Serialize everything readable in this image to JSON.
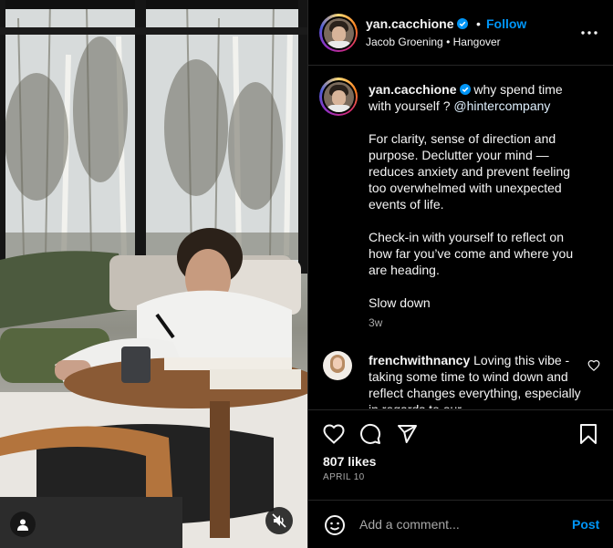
{
  "post": {
    "author": {
      "username": "yan.cacchione",
      "verified": true,
      "follow_label": "Follow",
      "separator": "•"
    },
    "header_sub": {
      "audio": "Jacob Groening",
      "dot": "•",
      "track": "Hangover"
    },
    "caption": {
      "username": "yan.cacchione",
      "line1": "why spend time with yourself ?",
      "mention": "@hintercompany",
      "para2": "For clarity, sense of direction and purpose. Declutter your mind — reduces anxiety and prevent feeling too overwhelmed with unexpected events of life.",
      "para3": "Check-in with yourself to reflect on how far you’ve come and where you are heading.",
      "para4": "Slow down",
      "time": "3w"
    },
    "comments": [
      {
        "username": "frenchwithnancy",
        "text": "Loving this vibe - taking some time to wind down and reflect changes everything, especially in regards to our"
      }
    ],
    "likes": "807 likes",
    "date": "APRIL 10"
  },
  "add_comment": {
    "placeholder": "Add a comment...",
    "post_label": "Post"
  },
  "icons": {
    "more": "more-options-icon",
    "like": "heart-icon",
    "comment": "comment-icon",
    "share": "share-icon",
    "save": "bookmark-icon",
    "emoji": "emoji-icon",
    "tags": "user-tag-icon",
    "mute": "audio-muted-icon"
  },
  "colors": {
    "accent": "#0095f6",
    "background": "#000000",
    "divider": "#262626",
    "secondary_text": "#a8a8a8"
  }
}
